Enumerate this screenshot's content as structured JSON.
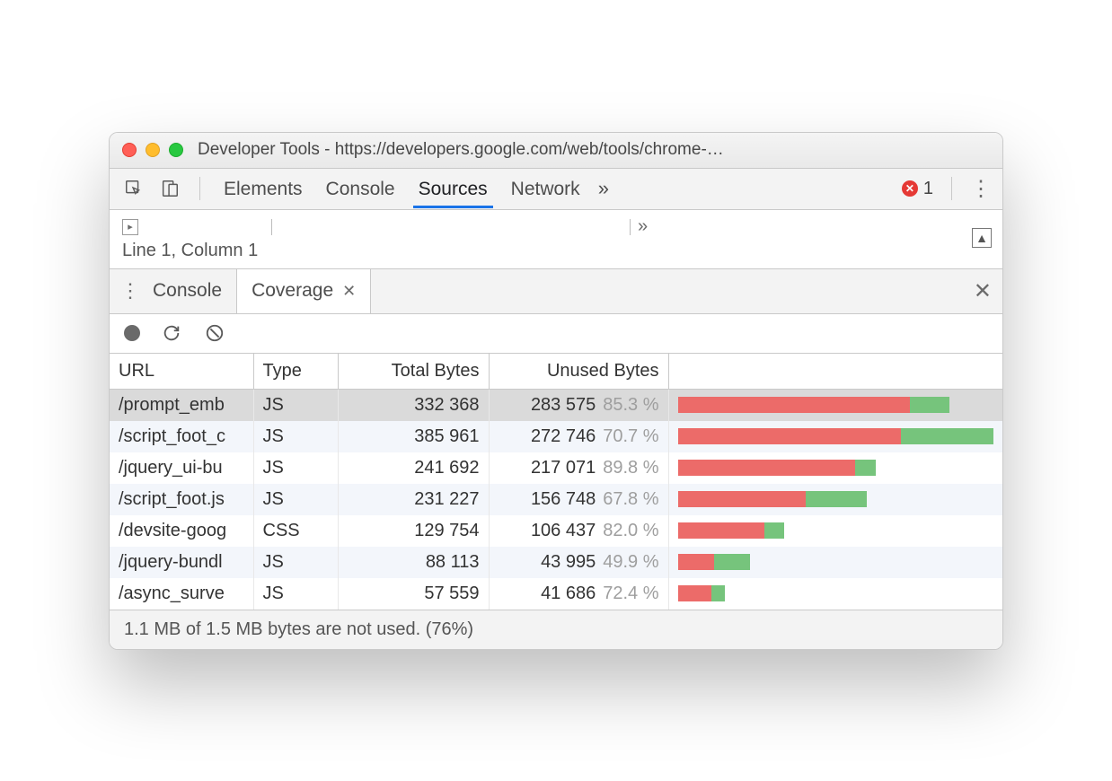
{
  "window": {
    "title": "Developer Tools - https://developers.google.com/web/tools/chrome-…"
  },
  "toolbar": {
    "tabs": [
      "Elements",
      "Console",
      "Sources",
      "Network"
    ],
    "active_tab_index": 2,
    "error_count": "1"
  },
  "editor": {
    "cursor": "Line 1, Column 1"
  },
  "drawer": {
    "tabs": [
      "Console",
      "Coverage"
    ],
    "active_tab_index": 1
  },
  "coverage": {
    "columns": [
      "URL",
      "Type",
      "Total Bytes",
      "Unused Bytes"
    ],
    "max_total_bytes": 385961,
    "rows": [
      {
        "url": "/prompt_emb",
        "type": "JS",
        "total": "332 368",
        "total_num": 332368,
        "unused": "283 575",
        "unused_num": 283575,
        "pct": "85.3 %",
        "selected": true
      },
      {
        "url": "/script_foot_c",
        "type": "JS",
        "total": "385 961",
        "total_num": 385961,
        "unused": "272 746",
        "unused_num": 272746,
        "pct": "70.7 %"
      },
      {
        "url": "/jquery_ui-bu",
        "type": "JS",
        "total": "241 692",
        "total_num": 241692,
        "unused": "217 071",
        "unused_num": 217071,
        "pct": "89.8 %"
      },
      {
        "url": "/script_foot.js",
        "type": "JS",
        "total": "231 227",
        "total_num": 231227,
        "unused": "156 748",
        "unused_num": 156748,
        "pct": "67.8 %"
      },
      {
        "url": "/devsite-goog",
        "type": "CSS",
        "total": "129 754",
        "total_num": 129754,
        "unused": "106 437",
        "unused_num": 106437,
        "pct": "82.0 %"
      },
      {
        "url": "/jquery-bundl",
        "type": "JS",
        "total": "88 113",
        "total_num": 88113,
        "unused": "43 995",
        "unused_num": 43995,
        "pct": "49.9 %"
      },
      {
        "url": "/async_surve",
        "type": "JS",
        "total": "57 559",
        "total_num": 57559,
        "unused": "41 686",
        "unused_num": 41686,
        "pct": "72.4 %"
      }
    ]
  },
  "footer": {
    "summary": "1.1 MB of 1.5 MB bytes are not used. (76%)"
  }
}
